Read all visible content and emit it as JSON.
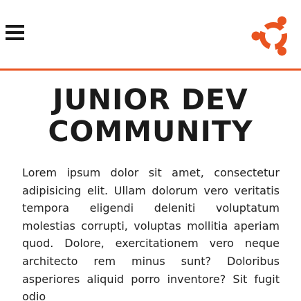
{
  "header": {
    "menu_icon": "hamburger-menu-icon",
    "logo_icon": "ubuntu-logo-icon",
    "logo_color": "#e95420",
    "rule_color": "#e95420"
  },
  "hero": {
    "title_line1": "JUNIOR DEV",
    "title_line2": "COMMUNITY",
    "paragraph": "Lorem ipsum dolor sit amet, consectetur adipisicing elit. Ullam dolorum vero veritatis tempora eligendi deleniti voluptatum molestias corrupti, voluptas mollitia aperiam quod. Dolore, exercitationem vero neque architecto rem minus sunt? Doloribus asperiores aliquid porro inventore? Sit fugit odio"
  }
}
